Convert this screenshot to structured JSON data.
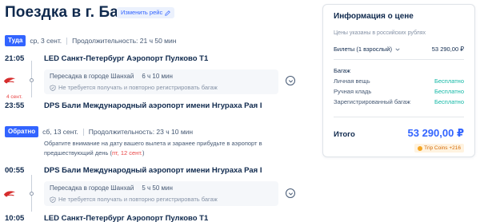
{
  "header": {
    "title": "Поездка в г. Бали",
    "edit_label": "Изменить рейс"
  },
  "outbound": {
    "badge": "Туда",
    "date": "ср, 3 сент.",
    "duration": "Продолжительность: 21 ч 50 мин",
    "depart_time": "21:05",
    "depart_airport": "LED Санкт-Петербург Аэропорт Пулково T1",
    "transfer_text": "Пересадка в городе Шанхай",
    "transfer_duration": "6 ч 10 мин",
    "baggage_note": "Не требуется получать и повторно регистрировать багаж",
    "arrive_day_note": "4 сент.",
    "arrive_time": "23:55",
    "arrive_airport": "DPS Бали Международный аэропорт имени Нгураха Рая I"
  },
  "return": {
    "badge": "Обратно",
    "date": "сб, 13 сент.",
    "duration": "Продолжительность: 23 ч 10 мин",
    "notice_text": "Обратите внимание на дату вашего вылета и заранее прибудьте в аэропорт в предшествующий день (",
    "notice_date": "пт, 12 сент.",
    "notice_end": ")",
    "depart_time": "00:55",
    "depart_airport": "DPS Бали Международный аэропорт имени Нгураха Рая I",
    "transfer_text": "Пересадка в городе Шанхай",
    "transfer_duration": "5 ч 50 мин",
    "baggage_note": "Не требуется получать и повторно регистрировать багаж",
    "arrive_time": "10:05",
    "arrive_airport": "LED Санкт-Петербург Аэропорт Пулково T1"
  },
  "price_panel": {
    "title": "Информация о цене",
    "subtitle": "Цены указаны в российских рублях",
    "tickets_label": "Билеты (1 взрослый)",
    "tickets_price": "53 290,00 ₽",
    "baggage_heading": "Багаж",
    "baggage_items": [
      {
        "label": "Личная вещь",
        "value": "Бесплатно"
      },
      {
        "label": "Ручная кладь",
        "value": "Бесплатно"
      },
      {
        "label": "Зарегистрированный багаж",
        "value": "Бесплатно"
      }
    ],
    "total_label": "Итого",
    "total_price": "53 290,00 ₽",
    "coins_label": "Trip Coins +216"
  },
  "colors": {
    "accent": "#3264ff",
    "free": "#14b8a6",
    "warning": "#e94545"
  }
}
